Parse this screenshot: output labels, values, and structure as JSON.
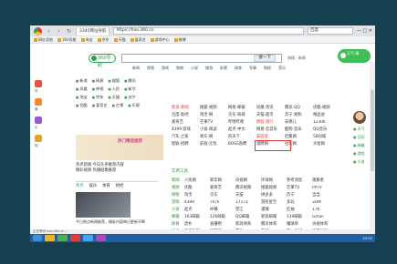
{
  "browser": {
    "tab_title": "2345网址导航",
    "address": "https://hao.360.cn",
    "search_hint": "百度",
    "window_controls": "— □ ✕"
  },
  "bookmarks": [
    "网址导航",
    "360导航",
    "淘宝",
    "京东",
    "天猫",
    "爱奇艺",
    "游戏中心",
    "微博"
  ],
  "page": {
    "logo_text": "360导航",
    "search_button": "搜一下",
    "search_aside": "热搜 · 新闻",
    "green_badge": "天气 晴",
    "hotbar": [
      "新闻",
      "视频",
      "游戏",
      "购物",
      "小说",
      "旅游",
      "彩票",
      "体育",
      "军事",
      "财经",
      "音乐"
    ],
    "left_links": [
      [
        "新浪",
        "网易",
        "搜狐",
        "腾讯"
      ],
      [
        "凤凰",
        "央视",
        "人民",
        "新华"
      ],
      [
        "淘宝",
        "京东",
        "天猫",
        "苏宁"
      ],
      [
        "优酷",
        "爱奇艺",
        "芒果",
        "乐视"
      ]
    ],
    "banner_title": "热门精选推荐",
    "promo_lines": [
      "热点新闻 今日头条推荐内容",
      "精彩视频 热播剧集推荐"
    ],
    "news_tabs": [
      "热点",
      "娱乐",
      "体育",
      "财经"
    ],
    "news_caption": "今日热点新闻推荐，精彩内容每日更新不断",
    "grid_rows": [
      [
        "新浪·新闻",
        "搜狐·视频",
        "网易·邮箱",
        "凤凰·资讯",
        "腾讯·QQ",
        "优酷·视频"
      ],
      [
        "百度·贴吧",
        "淘宝·网",
        "京东·商城",
        "天猫·超市",
        "苏宁·易购",
        "唯品会"
      ],
      [
        "爱奇艺",
        "芒果TV",
        "哔哩哔哩",
        "携程·旅行",
        "去哪儿",
        "12306"
      ],
      [
        "4399·游戏",
        "小说·阅读",
        "起点·中文",
        "网易·云音乐",
        "酷狗·音乐",
        "QQ音乐"
      ],
      [
        "汽车·之家",
        "易车·网",
        "房天下",
        "安居客",
        "赶集网",
        "58同城"
      ],
      [
        "智联·招聘",
        "前程·无忧",
        "BOSS直聘",
        "猎聘网",
        "拉勾网",
        "大街网"
      ]
    ],
    "section_head": "实用工具",
    "grid2_rows": [
      [
        "新闻",
        "人民网",
        "新华网",
        "央视网",
        "环球网",
        "参考消息",
        "观察者"
      ],
      [
        "视频",
        "优酷",
        "爱奇艺",
        "腾讯视频",
        "搜狐视频",
        "芒果TV",
        "PPTV"
      ],
      [
        "购物",
        "淘宝",
        "京东",
        "天猫",
        "拼多多",
        "苏宁",
        "当当"
      ],
      [
        "游戏",
        "4399",
        "7k7k",
        "17173",
        "游民星空",
        "多玩",
        "3DM"
      ],
      [
        "小说",
        "起点",
        "纵横",
        "晋江",
        "潇湘",
        "红袖",
        "17K"
      ],
      [
        "邮箱",
        "163邮箱",
        "126邮箱",
        "QQ邮箱",
        "新浪邮箱",
        "139邮箱",
        "Gmail"
      ],
      [
        "体育",
        "虎扑",
        "直播吧",
        "新浪体育",
        "腾讯体育",
        "懂球帝",
        "央视体育"
      ],
      [
        "财经",
        "东方财富",
        "同花顺",
        "雪球",
        "和讯",
        "第一财经",
        "证券时报"
      ]
    ],
    "right_panel": [
      "天气",
      "日历",
      "邮箱",
      "游戏",
      "小说"
    ],
    "side_labels": [
      "热",
      "娱",
      "乐",
      "购"
    ],
    "status_text": "正在等待 hao.360.cn..."
  },
  "taskbar": {
    "clock": "10:32"
  }
}
